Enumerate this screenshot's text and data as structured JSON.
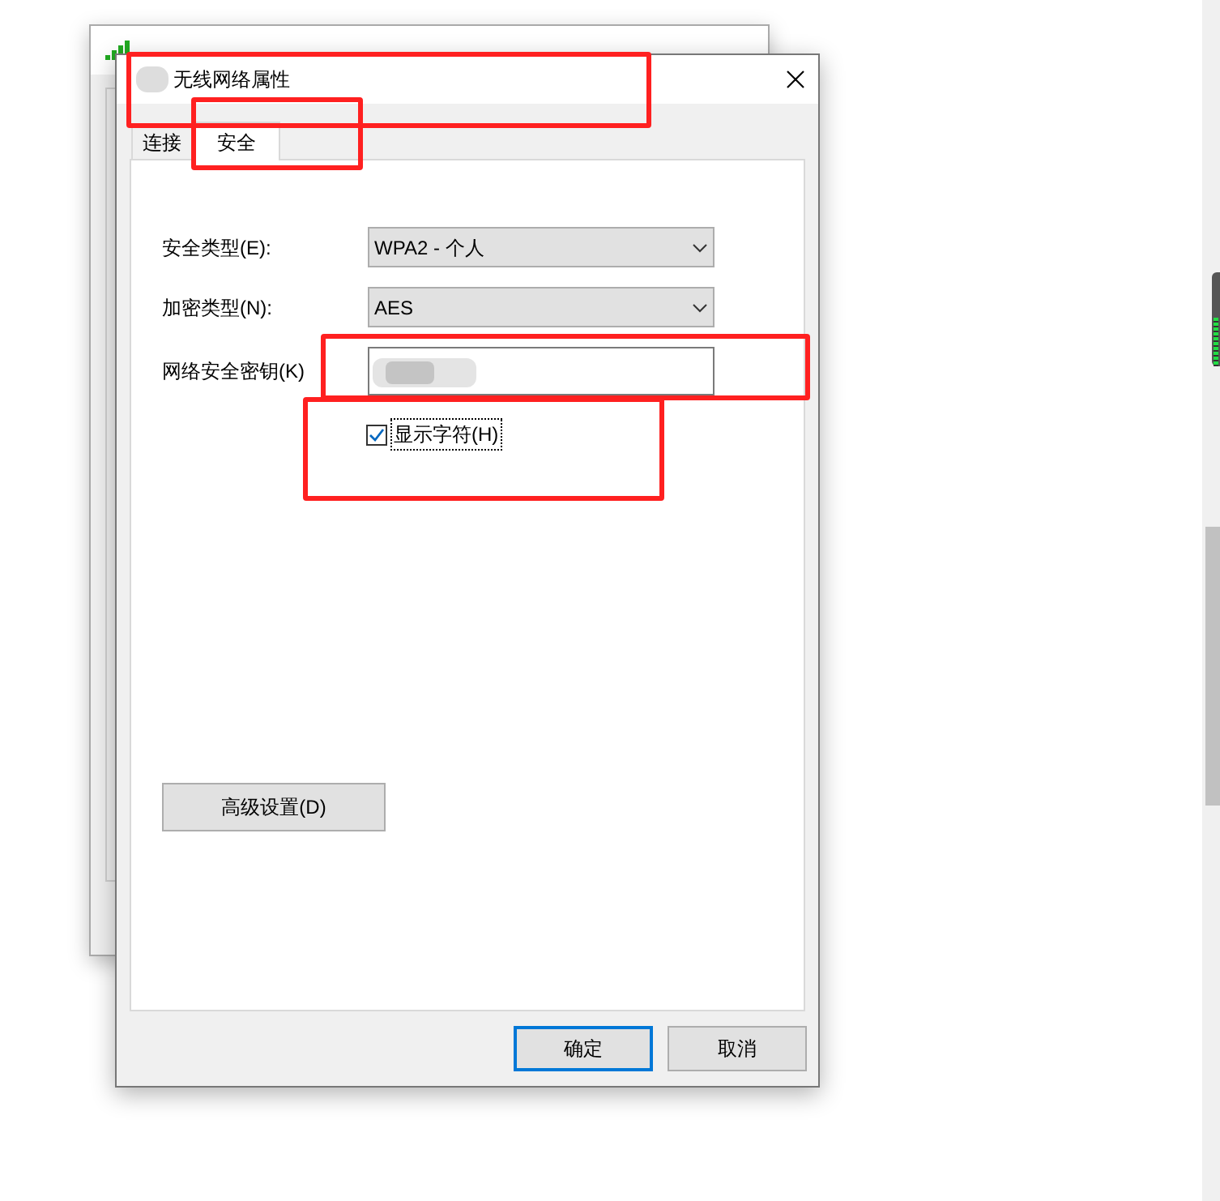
{
  "window": {
    "title": "无线网络属性"
  },
  "tabs": [
    {
      "label": "连接",
      "selected": false
    },
    {
      "label": "安全",
      "selected": true
    }
  ],
  "fields": [
    {
      "kind": "select",
      "label": "安全类型(E):",
      "value": "WPA2 - 个人"
    },
    {
      "kind": "select",
      "label": "加密类型(N):",
      "value": "AES"
    },
    {
      "kind": "password",
      "label": "网络安全密钥(K)"
    }
  ],
  "show_characters": {
    "label": "显示字符(H)",
    "checked": true
  },
  "advanced_button": "高级设置(D)",
  "buttons": [
    {
      "label": "确定",
      "default": true
    },
    {
      "label": "取消",
      "default": false
    }
  ]
}
